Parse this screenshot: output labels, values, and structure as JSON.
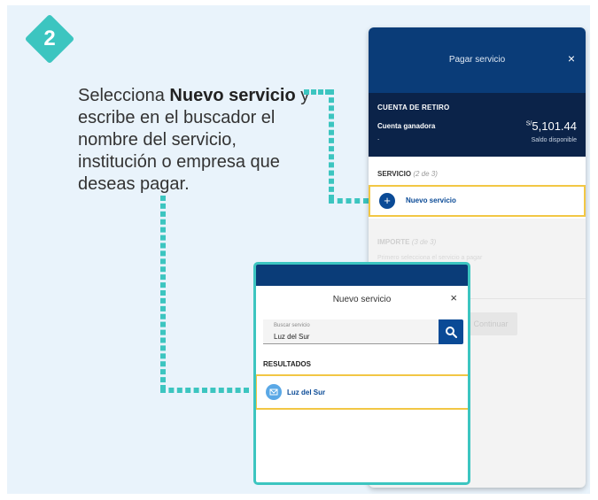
{
  "step": {
    "number": "2"
  },
  "instruction": {
    "before": "Selecciona ",
    "bold": "Nuevo servicio",
    "after": " y escribe en el buscador el nombre del servicio, institución o empresa que deseas pagar."
  },
  "panel": {
    "header_title": "Pagar servicio",
    "close": "×",
    "account": {
      "label": "CUENTA DE RETIRO",
      "name": "Cuenta ganadora",
      "dot": ".",
      "currency": "S/",
      "amount": "5,101.44",
      "available": "Saldo disponible"
    },
    "servicio_label": "SERVICIO",
    "servicio_step": "(2 de 3)",
    "nuevo_servicio": "Nuevo servicio",
    "plus": "+",
    "importe_label": "IMPORTE",
    "importe_step": "(3 de 3)",
    "importe_sub": "Primero selecciona el servicio a pagar",
    "continuar": "Continuar"
  },
  "modal": {
    "title": "Nuevo servicio",
    "close": "×",
    "search_placeholder": "Buscar servicio",
    "search_value": "Luz del Sur",
    "results_label": "RESULTADOS",
    "result_item": "Luz del Sur"
  },
  "colors": {
    "accent_teal": "#3cc5c0",
    "highlight_yellow": "#f2c744",
    "navy": "#0a3c78",
    "dark_navy": "#0b2349",
    "link_blue": "#0a4a96"
  },
  "icons": {
    "search": "search-icon",
    "close": "close-icon",
    "plus": "plus-icon",
    "service": "envelope-icon"
  }
}
